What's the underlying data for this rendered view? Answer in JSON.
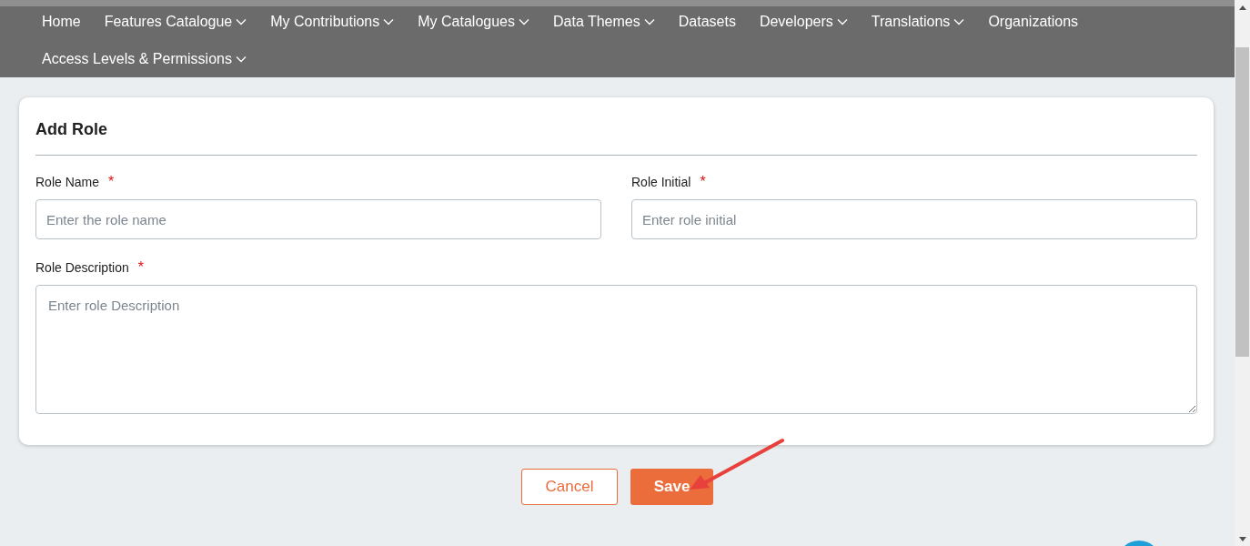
{
  "nav": {
    "items": [
      {
        "label": "Home",
        "dropdown": false
      },
      {
        "label": "Features Catalogue",
        "dropdown": true
      },
      {
        "label": "My Contributions",
        "dropdown": true
      },
      {
        "label": "My Catalogues",
        "dropdown": true
      },
      {
        "label": "Data Themes",
        "dropdown": true
      },
      {
        "label": "Datasets",
        "dropdown": false
      },
      {
        "label": "Developers",
        "dropdown": true
      },
      {
        "label": "Translations",
        "dropdown": true
      },
      {
        "label": "Organizations",
        "dropdown": false
      },
      {
        "label": "Access Levels & Permissions",
        "dropdown": true
      }
    ]
  },
  "form": {
    "title": "Add Role",
    "fields": [
      {
        "kind": "input",
        "label": "Role Name",
        "required_mark": "*",
        "placeholder": "Enter the role name"
      },
      {
        "kind": "input",
        "label": "Role Initial",
        "required_mark": "*",
        "placeholder": "Enter role initial"
      },
      {
        "kind": "textarea",
        "label": "Role Description",
        "required_mark": "*",
        "placeholder": "Enter role Description"
      }
    ]
  },
  "buttons": [
    {
      "label": "Cancel",
      "kind": "secondary"
    },
    {
      "label": "Save",
      "kind": "primary"
    }
  ]
}
